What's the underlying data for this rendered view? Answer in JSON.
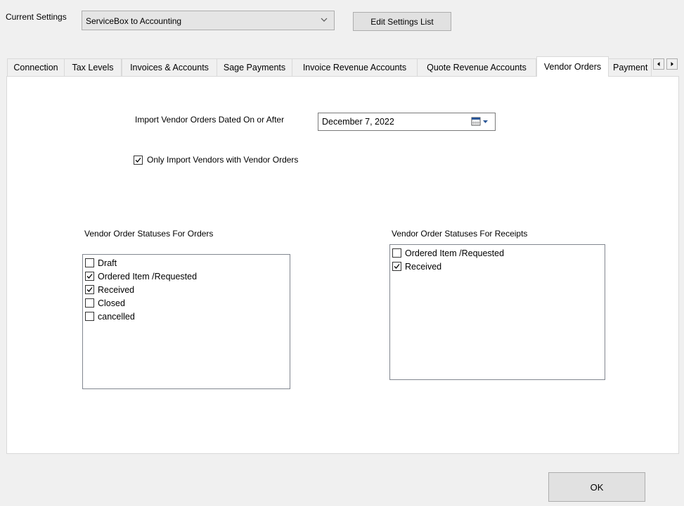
{
  "header": {
    "current_settings_label": "Current Settings",
    "current_settings_value": "ServiceBox to Accounting",
    "edit_button_label": "Edit Settings List"
  },
  "tabs": [
    {
      "label": "Connection",
      "active": false
    },
    {
      "label": "Tax Levels",
      "active": false
    },
    {
      "label": "Invoices & Accounts",
      "active": false
    },
    {
      "label": "Sage Payments",
      "active": false
    },
    {
      "label": "Invoice Revenue Accounts",
      "active": false
    },
    {
      "label": "Quote Revenue Accounts",
      "active": false
    },
    {
      "label": "Vendor Orders",
      "active": true
    },
    {
      "label": "Payment",
      "active": false
    }
  ],
  "vendor_orders": {
    "import_date_label": "Import Vendor Orders Dated On or After",
    "import_date_value": "December   7, 2022",
    "only_import_label": "Only Import Vendors with Vendor Orders",
    "only_import_checked": true,
    "orders_list_title": "Vendor Order Statuses For Orders",
    "orders_statuses": [
      {
        "label": "Draft",
        "checked": false
      },
      {
        "label": "Ordered Item /Requested",
        "checked": true
      },
      {
        "label": "Received",
        "checked": true
      },
      {
        "label": "Closed",
        "checked": false
      },
      {
        "label": "cancelled",
        "checked": false
      }
    ],
    "receipts_list_title": "Vendor Order Statuses For Receipts",
    "receipts_statuses": [
      {
        "label": "Ordered Item /Requested",
        "checked": false
      },
      {
        "label": "Received",
        "checked": true
      }
    ]
  },
  "footer": {
    "ok_label": "OK"
  },
  "colors": {
    "window_bg": "#f0f0f0",
    "panel_bg": "#ffffff",
    "button_bg": "#e1e1e1",
    "border": "#adadad",
    "calendar_icon_blue": "#2b5797"
  },
  "icons": {
    "combo_arrow": "chevron-down-icon",
    "date_picker": "calendar-icon",
    "tab_scroll_left": "arrow-left-icon",
    "tab_scroll_right": "arrow-right-icon",
    "check": "checkmark-icon"
  }
}
